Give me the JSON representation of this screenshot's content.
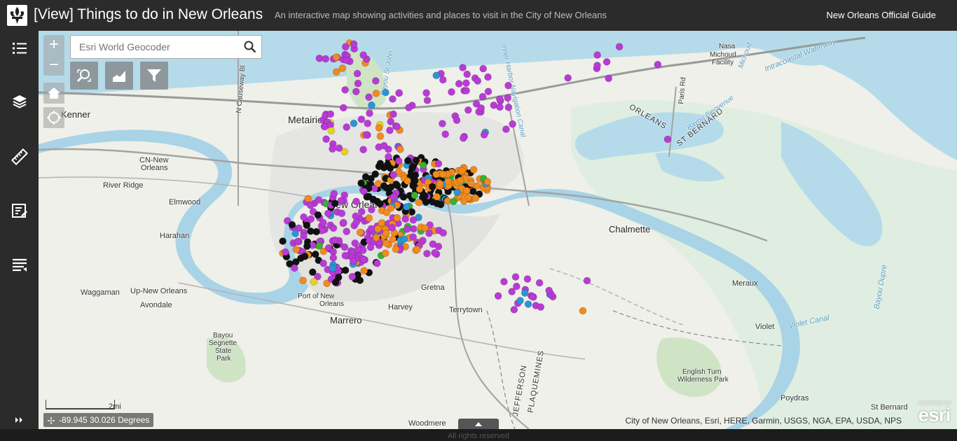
{
  "header": {
    "title": "[View] Things to do in New Orleans",
    "subtitle": "An interactive map showing activities and places to visit in the City of New Orleans",
    "guide_link": "New Orleans Official Guide"
  },
  "sidebar": {
    "items": [
      {
        "icon": "legend-list-icon"
      },
      {
        "icon": "layers-icon"
      },
      {
        "icon": "measure-ruler-icon"
      },
      {
        "icon": "edit-notes-icon"
      },
      {
        "icon": "layer-list-icon"
      }
    ],
    "expand_icon": "double-chevron-right-icon"
  },
  "map": {
    "zoom_in": "+",
    "zoom_out": "−",
    "search_placeholder": "Esri World Geocoder",
    "coordinates": "-89.945 30.026 Degrees",
    "scale_label": "2mi",
    "attribution": "City of New Orleans, Esri, HERE, Garmin, USGS, NGA, EPA, USDA, NPS",
    "esri_powered": "POWERED BY",
    "esri_word": "esri",
    "point_colors": {
      "purple": "#b93ad6",
      "black": "#111111",
      "orange": "#f28a1d",
      "blue": "#2b95d6",
      "green": "#34b233",
      "yellow": "#e8d21b"
    },
    "places": {
      "kenner": "Kenner",
      "metairie": "Metairie",
      "new_orleans": "New Orleans",
      "river_ridge": "River Ridge",
      "elmwood": "Elmwood",
      "harahan": "Harahan",
      "cn_new_orleans_1": "CN-New",
      "cn_new_orleans_2": "Orleans",
      "chalmette": "Chalmette",
      "waggaman": "Waggaman",
      "up_new_orleans": "Up-New Orleans",
      "avondale": "Avondale",
      "harvey": "Harvey",
      "marrero": "Marrero",
      "gretna": "Gretna",
      "terrytown": "Terrytown",
      "port_1": "Port of New",
      "port_2": "Orleans",
      "bayou_segnette_1": "Bayou",
      "bayou_segnette_2": "Segnette",
      "bayou_segnette_3": "State",
      "bayou_segnette_4": "Park",
      "nasa_1": "Nasa",
      "nasa_2": "Michoud",
      "nasa_3": "Facility",
      "orleans_parish": "ORLEANS",
      "st_bernard_parish": "ST BERNARD",
      "meraux": "Meraux",
      "violet": "Violet",
      "english_turn_1": "English Turn",
      "english_turn_2": "Wilderness Park",
      "poydras": "Poydras",
      "st_bernard": "St Bernard",
      "woodmere": "Woodmere",
      "jefferson": "JEFFERSON",
      "plaquemines": "PLAQUEMINES",
      "intracoastal": "Intracoastal Waterway",
      "violet_canal": "Violet Canal",
      "bayou_dupre": "Bayou Dupre",
      "bayou_bienvenue": "Bayou Bienvenue",
      "inner_harbor": "Inner Harbor Navigation Canal",
      "bayou_st_john": "Bayou St John",
      "michoud": "Michoud",
      "causeway": "N Causeway Bl",
      "paris_rd": "Paris Rd"
    }
  },
  "footer": {
    "text": "All rights reserved"
  }
}
